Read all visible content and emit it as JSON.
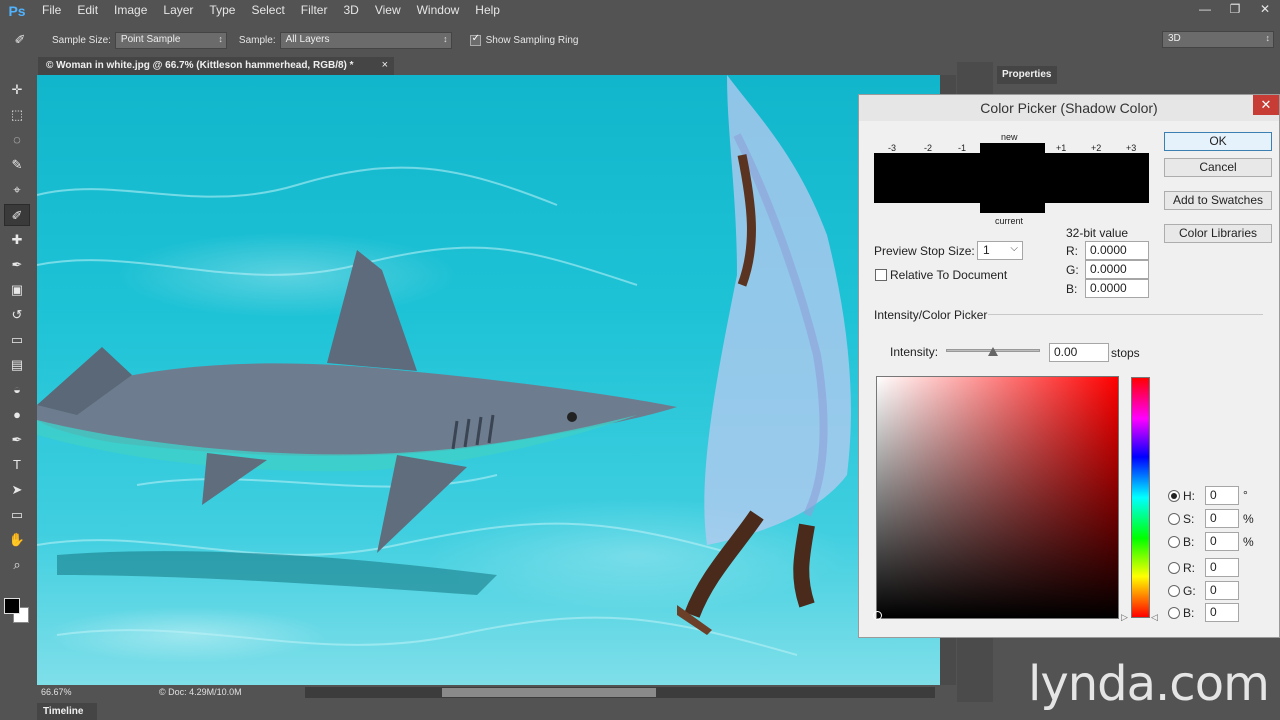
{
  "app": {
    "logo": "Ps"
  },
  "menu": [
    "File",
    "Edit",
    "Image",
    "Layer",
    "Type",
    "Select",
    "Filter",
    "3D",
    "View",
    "Window",
    "Help"
  ],
  "window_controls": {
    "minimize": "—",
    "restore": "❐",
    "close": "✕"
  },
  "options": {
    "sample_size_label": "Sample Size:",
    "sample_size_value": "Point Sample",
    "sample_label": "Sample:",
    "sample_value": "All Layers",
    "show_ring_label": "Show Sampling Ring",
    "show_ring_checked": true,
    "workspace": "3D"
  },
  "document": {
    "tab_title": "© Woman in white.jpg @ 66.7% (Kittleson hammerhead, RGB/8) *",
    "close": "×"
  },
  "status": {
    "zoom": "66.67%",
    "doc_info": "© Doc: 4.29M/10.0M",
    "scroll_position": 0.33
  },
  "timeline": {
    "label": "Timeline"
  },
  "panels": {
    "properties": "Properties"
  },
  "dialog": {
    "title": "Color Picker (Shadow Color)",
    "close": "✕",
    "buttons": {
      "ok": "OK",
      "cancel": "Cancel",
      "add_swatches": "Add to Swatches",
      "color_libraries": "Color Libraries"
    },
    "preview": {
      "stops_left": [
        "-3",
        "-2",
        "-1"
      ],
      "stops_right": [
        "+1",
        "+2",
        "+3"
      ],
      "new_label": "new",
      "current_label": "current",
      "color": "#000000"
    },
    "preview_stop_size_label": "Preview Stop Size:",
    "preview_stop_size_value": "1",
    "relative_label": "Relative To Document",
    "relative_checked": false,
    "bit32": {
      "title": "32-bit value",
      "r_label": "R:",
      "r": "0.0000",
      "g_label": "G:",
      "g": "0.0000",
      "b_label": "B:",
      "b": "0.0000"
    },
    "section_label": "Intensity/Color Picker",
    "intensity_label": "Intensity:",
    "intensity_value": "0.00",
    "intensity_unit": "stops",
    "hsb": {
      "h_label": "H:",
      "h": "0",
      "h_unit": "°",
      "s_label": "S:",
      "s": "0",
      "s_unit": "%",
      "b_label": "B:",
      "b": "0",
      "b_unit": "%"
    },
    "rgb": {
      "r_label": "R:",
      "r": "0",
      "g_label": "G:",
      "g": "0",
      "b_label": "B:",
      "b": "0"
    },
    "selected_mode": "H"
  },
  "watermark": "lynda.com",
  "tools": [
    {
      "name": "move-tool-icon",
      "glyph": "✛"
    },
    {
      "name": "marquee-tool-icon",
      "glyph": "⬚"
    },
    {
      "name": "lasso-tool-icon",
      "glyph": "◌"
    },
    {
      "name": "quick-select-tool-icon",
      "glyph": "✎"
    },
    {
      "name": "crop-tool-icon",
      "glyph": "⌖"
    },
    {
      "name": "eyedropper-tool-icon",
      "glyph": "✐"
    },
    {
      "name": "healing-tool-icon",
      "glyph": "✚"
    },
    {
      "name": "brush-tool-icon",
      "glyph": "✒"
    },
    {
      "name": "stamp-tool-icon",
      "glyph": "▣"
    },
    {
      "name": "history-brush-tool-icon",
      "glyph": "↺"
    },
    {
      "name": "eraser-tool-icon",
      "glyph": "▭"
    },
    {
      "name": "gradient-tool-icon",
      "glyph": "▤"
    },
    {
      "name": "blur-tool-icon",
      "glyph": "◒"
    },
    {
      "name": "dodge-tool-icon",
      "glyph": "●"
    },
    {
      "name": "pen-tool-icon",
      "glyph": "✒"
    },
    {
      "name": "type-tool-icon",
      "glyph": "T"
    },
    {
      "name": "path-select-tool-icon",
      "glyph": "➤"
    },
    {
      "name": "shape-tool-icon",
      "glyph": "▭"
    },
    {
      "name": "hand-tool-icon",
      "glyph": "✋"
    },
    {
      "name": "zoom-tool-icon",
      "glyph": "⌕"
    }
  ]
}
